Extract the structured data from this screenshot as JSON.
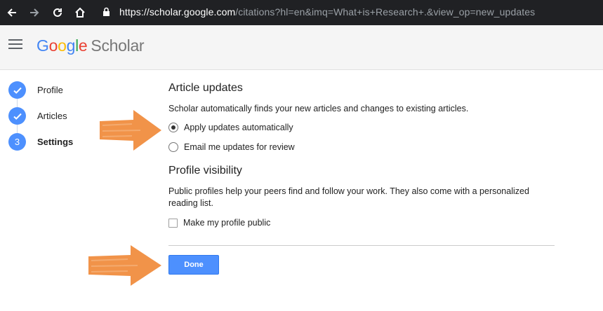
{
  "browser": {
    "url_host": "https://scholar.google.com",
    "url_path": "/citations?hl=en&imq=What+is+Research+.&view_op=new_updates",
    "icons": [
      "back-arrow-icon",
      "forward-arrow-icon",
      "reload-icon",
      "home-icon",
      "lock-icon"
    ]
  },
  "header": {
    "logo_letters": [
      "G",
      "o",
      "o",
      "g",
      "l",
      "e"
    ],
    "logo_product": "Scholar"
  },
  "steps": [
    {
      "label": "Profile",
      "marker": "✓",
      "state": "complete"
    },
    {
      "label": "Articles",
      "marker": "✓",
      "state": "complete"
    },
    {
      "label": "Settings",
      "marker": "3",
      "state": "active"
    }
  ],
  "article_updates": {
    "title": "Article updates",
    "description": "Scholar automatically finds your new articles and changes to existing articles.",
    "options": [
      {
        "label": "Apply updates automatically",
        "selected": true
      },
      {
        "label": "Email me updates for review",
        "selected": false
      }
    ]
  },
  "profile_visibility": {
    "title": "Profile visibility",
    "description": "Public profiles help your peers find and follow your work. They also come with a personalized reading list.",
    "checkbox_label": "Make my profile public",
    "checked": false
  },
  "done_label": "Done",
  "colors": {
    "accent": "#4d90fe",
    "annotation_arrow": "#f08a3a",
    "chrome_bg": "#202124",
    "header_bg": "#f5f5f5"
  }
}
